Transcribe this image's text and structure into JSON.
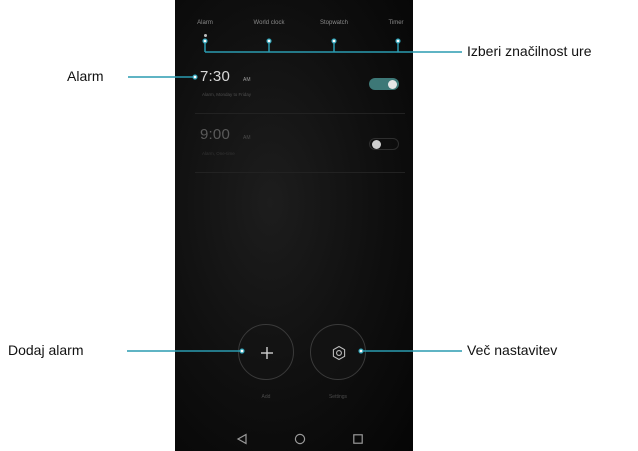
{
  "tabs": [
    {
      "label": "Alarm"
    },
    {
      "label": "World clock"
    },
    {
      "label": "Stopwatch"
    },
    {
      "label": "Timer"
    }
  ],
  "alarms": [
    {
      "time": "7:30",
      "ampm": "AM",
      "repeat": "Alarm, Monday to Friday",
      "enabled": true
    },
    {
      "time": "9:00",
      "ampm": "AM",
      "repeat": "Alarm, One-time",
      "enabled": false
    }
  ],
  "buttons": {
    "add_label": "Add",
    "settings_label": "Settings"
  },
  "callouts": {
    "tabs": "Izberi značilnost ure",
    "alarm": "Alarm",
    "add": "Dodaj alarm",
    "settings": "Več nastavitev"
  },
  "colors": {
    "accent": "#3d7877",
    "callout_line": "#2a9bb0"
  }
}
